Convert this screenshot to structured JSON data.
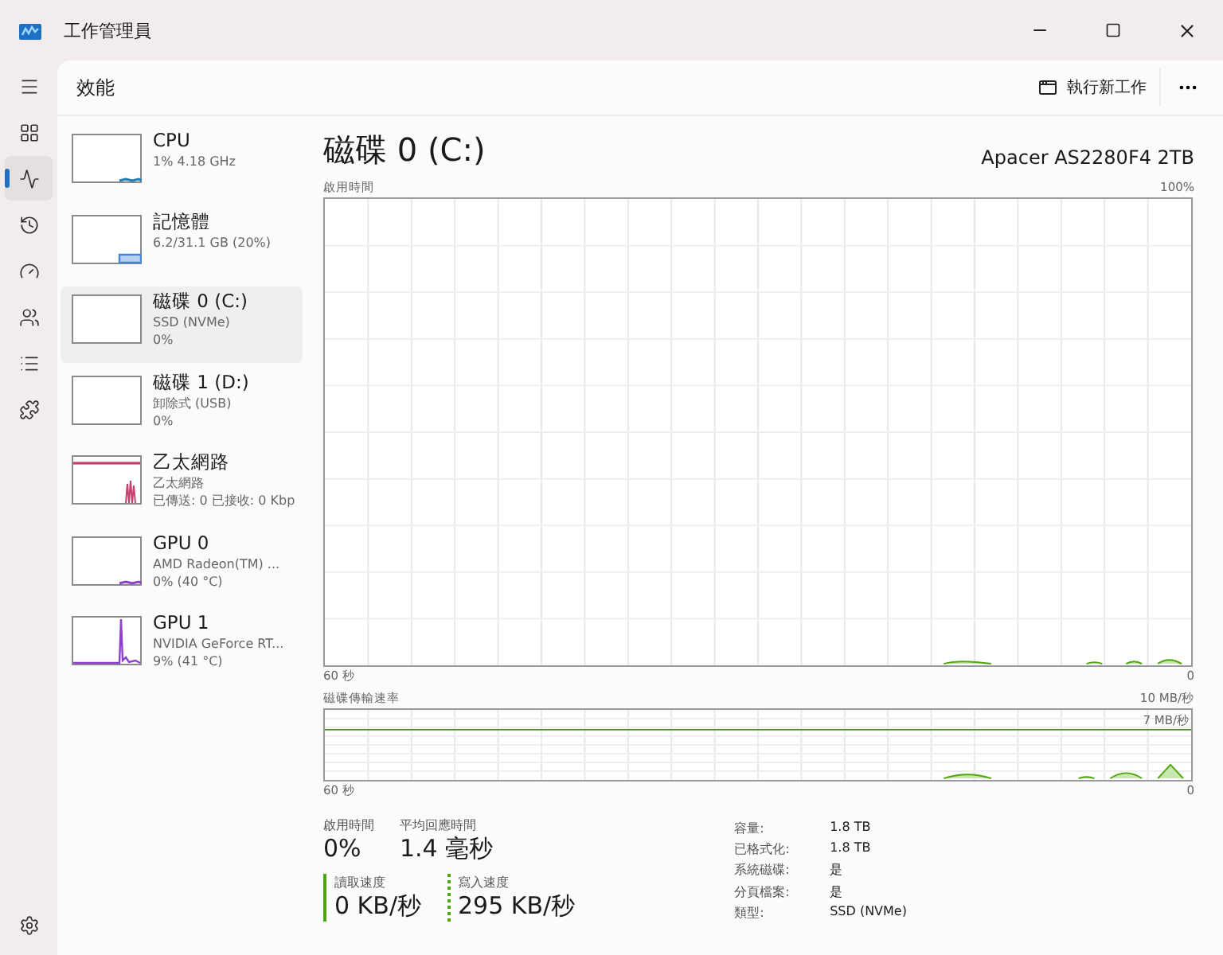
{
  "window": {
    "title": "工作管理員"
  },
  "nav": {
    "items": [
      {
        "kind": "menu",
        "selected": false
      },
      {
        "kind": "processes",
        "selected": false
      },
      {
        "kind": "performance",
        "selected": true
      },
      {
        "kind": "history",
        "selected": false
      },
      {
        "kind": "startup",
        "selected": false
      },
      {
        "kind": "users",
        "selected": false
      },
      {
        "kind": "details",
        "selected": false
      },
      {
        "kind": "services",
        "selected": false
      }
    ],
    "settings": {
      "kind": "settings",
      "selected": false
    }
  },
  "header": {
    "title": "效能",
    "run_task": "執行新工作"
  },
  "devices": [
    {
      "name": "CPU",
      "lines": [
        "1% 4.18 GHz"
      ],
      "selected": false,
      "color": "#1f7fc0",
      "kind": "low"
    },
    {
      "name": "記憶體",
      "lines": [
        "6.2/31.1 GB (20%)"
      ],
      "selected": false,
      "color": "#4a86d4",
      "kind": "fill"
    },
    {
      "name": "磁碟 0 (C:)",
      "lines": [
        "SSD (NVMe)",
        "0%"
      ],
      "selected": true,
      "kind": "empty"
    },
    {
      "name": "磁碟 1 (D:)",
      "lines": [
        "卸除式 (USB)",
        "0%"
      ],
      "selected": false,
      "kind": "empty"
    },
    {
      "name": "乙太網路",
      "lines": [
        "乙太網路",
        "已傳送: 0 已接收: 0 Kbp"
      ],
      "selected": false,
      "color": "#c4406e",
      "kind": "spikes"
    },
    {
      "name": "GPU 0",
      "lines": [
        "AMD Radeon(TM) ...",
        "0% (40 °C)"
      ],
      "selected": false,
      "color": "#8e3fd0",
      "kind": "low"
    },
    {
      "name": "GPU 1",
      "lines": [
        "NVIDIA GeForce RT...",
        "9% (41 °C)"
      ],
      "selected": false,
      "color": "#8e3fd0",
      "kind": "spike"
    }
  ],
  "detail": {
    "title": "磁碟 0 (C:)",
    "model": "Apacer AS2280F4 2TB",
    "usage_chart": {
      "label": "啟用時間",
      "max": "100%",
      "x_start": "60 秒",
      "x_end": "0"
    },
    "rate_chart": {
      "label": "磁碟傳輸速率",
      "max": "10 MB/秒",
      "marker": "7 MB/秒",
      "x_start": "60 秒",
      "x_end": "0"
    },
    "stats": [
      {
        "label": "啟用時間",
        "value": "0%"
      },
      {
        "label": "平均回應時間",
        "value": "1.4 毫秒"
      }
    ],
    "speeds": [
      {
        "label": "讀取速度",
        "value": "0 KB/秒",
        "kind": "read"
      },
      {
        "label": "寫入速度",
        "value": "295 KB/秒",
        "kind": "write"
      }
    ],
    "properties": [
      {
        "label": "容量:",
        "value": "1.8 TB"
      },
      {
        "label": "已格式化:",
        "value": "1.8 TB"
      },
      {
        "label": "系統磁碟:",
        "value": "是"
      },
      {
        "label": "分頁檔案:",
        "value": "是"
      },
      {
        "label": "類型:",
        "value": "SSD (NVMe)"
      }
    ]
  }
}
